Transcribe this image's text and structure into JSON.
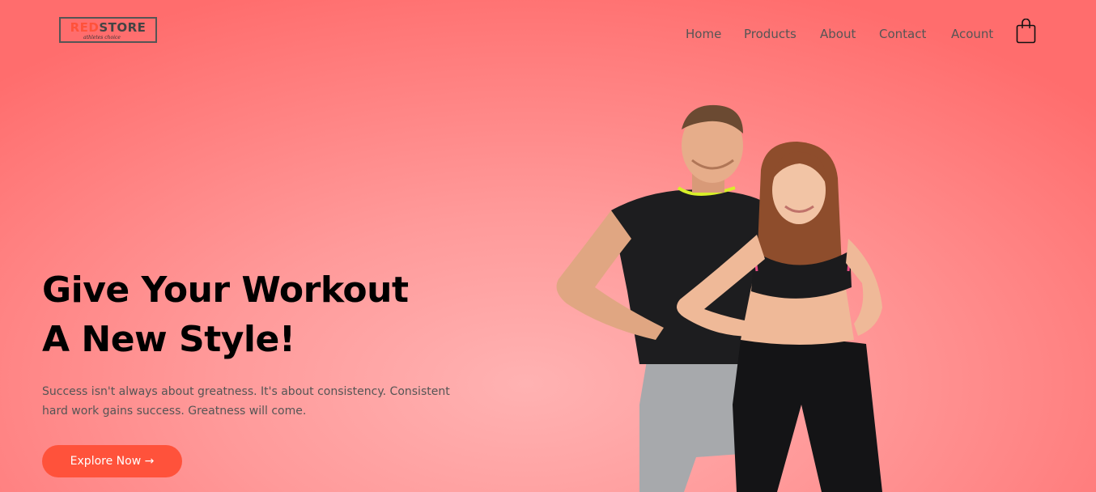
{
  "header": {
    "logo": {
      "brand_red": "RED",
      "brand_dark": "STORE",
      "tagline": "athletes choice"
    },
    "nav": [
      {
        "label": "Home"
      },
      {
        "label": "Products"
      },
      {
        "label": "About"
      },
      {
        "label": "Contact"
      },
      {
        "label": "Acount"
      }
    ],
    "cart_icon": "shopping-bag-icon"
  },
  "hero": {
    "title_line1": "Give Your Workout",
    "title_line2": "A New Style!",
    "description_line1": "Success isn't always about greatness. It's about consistency. Consistent",
    "description_line2": "hard work gains success. Greatness will come.",
    "cta_label": "Explore Now →",
    "image": "fitness-couple-image"
  },
  "colors": {
    "accent": "#ff523b",
    "background": "#ff8a8a",
    "text": "#555555",
    "heading": "#000000"
  }
}
